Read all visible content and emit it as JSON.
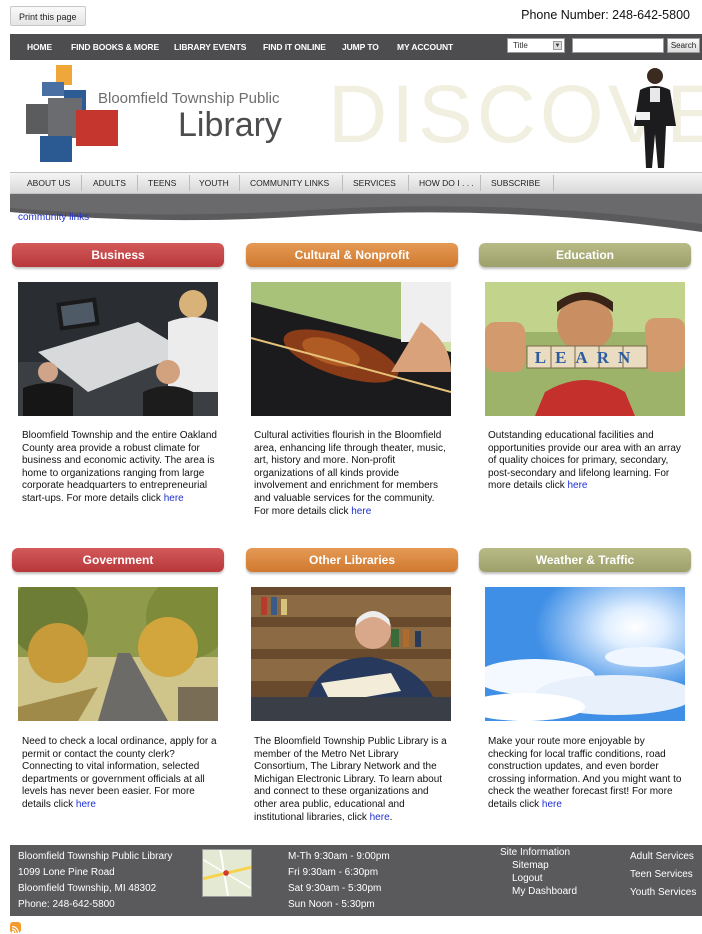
{
  "topbar": {
    "print_label": "Print this page",
    "phone": "Phone Number: 248-642-5800"
  },
  "mainnav": {
    "items": [
      "HOME",
      "FIND BOOKS & MORE",
      "LIBRARY EVENTS",
      "FIND IT ONLINE",
      "JUMP TO",
      "MY ACCOUNT"
    ],
    "search_scope": "Title",
    "search_value": "",
    "search_button": "Search"
  },
  "banner": {
    "name_small": "Bloomfield Township Public",
    "name_big": "Library",
    "tagline_bg": "DISCOVER"
  },
  "subnav": {
    "items": [
      "ABOUT US",
      "ADULTS",
      "TEENS",
      "YOUTH",
      "COMMUNITY LINKS",
      "SERVICES",
      "HOW DO I . . .",
      "SUBSCRIBE"
    ]
  },
  "breadcrumb": "community links",
  "categories": [
    {
      "title": "Business",
      "text": "Bloomfield Township and the entire Oakland County area provide a robust climate for business and economic activity. The area is home to organizations ranging from large corporate headquarters to entrepreneurial start-ups.  For more details click ",
      "link": "here"
    },
    {
      "title": "Cultural & Nonprofit",
      "text": "Cultural activities flourish in the Bloomfield area, enhancing life through theater, music, art, history and more.  Non-profit organizations of all kinds provide involvement and enrichment for members and valuable services for the community.   For more details click ",
      "link": "here"
    },
    {
      "title": "Education",
      "text": "Outstanding educational facilities and opportunities provide our area with an array of quality choices for primary, secondary, post-secondary and lifelong learning.  For more details click ",
      "link": "here"
    },
    {
      "title": "Government",
      "text": "Need to check a local ordinance, apply for a permit or contact the county clerk?  Connecting to vital information, selected departments or government officials at all levels has never been easier.  For more details click ",
      "link": "here"
    },
    {
      "title": "Other Libraries",
      "text": "The Bloomfield Township Public Library is a member of the Metro Net Library Consortium, The Library Network and the Michigan Electronic Library.  To learn about and connect to these organizations and other area public, educational and institutional libraries, click ",
      "link": "here",
      "link_suffix": "."
    },
    {
      "title": "Weather & Traffic",
      "text": "Make your route more enjoyable by checking for local traffic conditions, road construction updates, and even border crossing information.  And you might want to check the weather forecast first!  For more details click ",
      "link": "here"
    }
  ],
  "education_blocks": "LEARN",
  "footer": {
    "address": [
      "Bloomfield Township Public Library",
      "1099 Lone Pine Road",
      "Bloomfield Township, MI 48302",
      "Phone: 248-642-5800"
    ],
    "hours": [
      "M-Th 9:30am - 9:00pm",
      "Fri 9:30am - 6:30pm",
      "Sat 9:30am - 5:30pm",
      "Sun Noon - 5:30pm"
    ],
    "site_info_title": "Site Information",
    "site_links": [
      "Sitemap",
      "Logout",
      "My Dashboard"
    ],
    "services": [
      "Adult Services",
      "Teen Services",
      "Youth Services"
    ]
  },
  "colors": {
    "nav_bg": "#4d4d4f",
    "red_button": "#c0444a",
    "orange_button": "#d9833c",
    "olive_button": "#a9ab77",
    "link_blue": "#1d2fd6",
    "footer_bg": "#5a5a5c",
    "rss": "#f39a2d"
  }
}
